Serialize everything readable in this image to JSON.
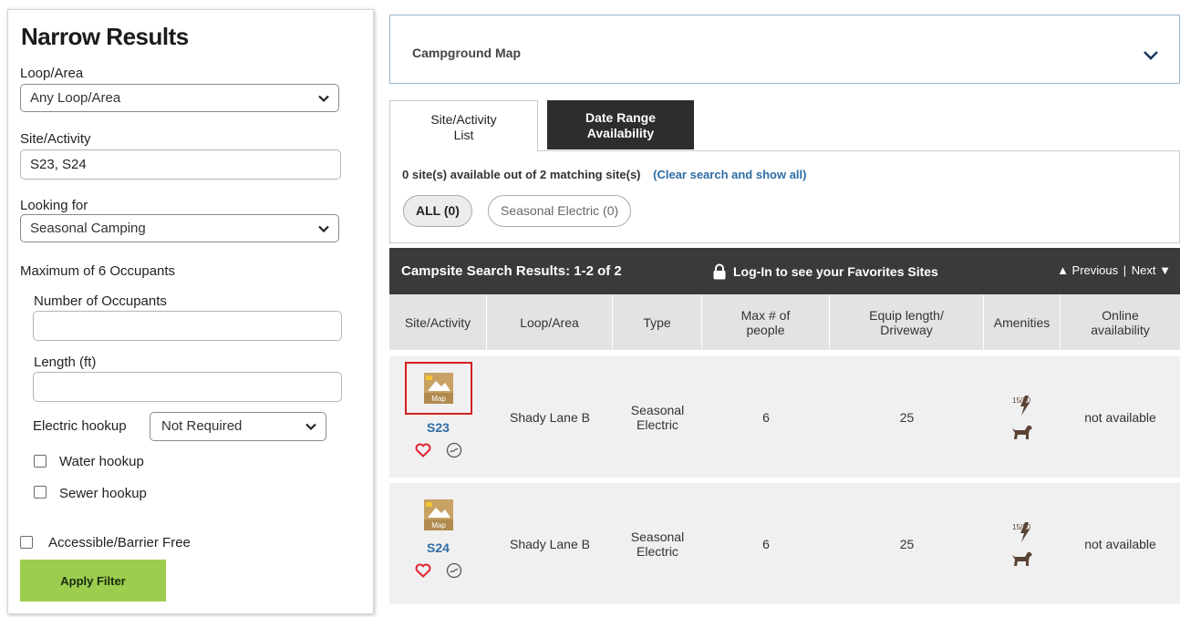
{
  "sidebar": {
    "title": "Narrow Results",
    "loop_label": "Loop/Area",
    "loop_value": "Any Loop/Area",
    "site_label": "Site/Activity",
    "site_value": "S23, S24",
    "looking_label": "Looking for",
    "looking_value": "Seasonal Camping",
    "max_occupants": "Maximum of 6 Occupants",
    "occupants_label": "Number of Occupants",
    "occupants_value": "",
    "length_label": "Length (ft)",
    "length_value": "",
    "electric_label": "Electric hookup",
    "electric_value": "Not Required",
    "water_label": "Water hookup",
    "sewer_label": "Sewer hookup",
    "accessible_label": "Accessible/Barrier Free",
    "apply_label": "Apply Filter"
  },
  "map_bar": {
    "label": "Campground Map"
  },
  "tabs": {
    "site_line1": "Site/Activity",
    "site_line2": "List",
    "date_line1": "Date Range",
    "date_line2": "Availability"
  },
  "results": {
    "availability_text": "0 site(s) available out of 2 matching site(s)",
    "clear_link": "(Clear search and show all)",
    "filter_all": "ALL (0)",
    "filter_seasonal": "Seasonal Electric (0)"
  },
  "header": {
    "title": "Campsite Search Results: 1-2 of 2",
    "login_text": "Log-In to see your Favorites Sites",
    "previous": "▲ Previous",
    "separator": "|",
    "next": "Next ▼"
  },
  "table": {
    "columns": {
      "site": "Site/Activity",
      "loop": "Loop/Area",
      "type": "Type",
      "max_line1": "Max # of",
      "max_line2": "people",
      "equip_line1": "Equip length/",
      "equip_line2": "Driveway",
      "amenities": "Amenities",
      "online_line1": "Online",
      "online_line2": "availability"
    },
    "rows": [
      {
        "site": "S23",
        "loop": "Shady Lane B",
        "type_line1": "Seasonal",
        "type_line2": "Electric",
        "max_people": "6",
        "equip_length": "25",
        "availability": "not available",
        "map_badge": "Map",
        "amp_text": "15/30"
      },
      {
        "site": "S24",
        "loop": "Shady Lane B",
        "type_line1": "Seasonal",
        "type_line2": "Electric",
        "max_people": "6",
        "equip_length": "25",
        "availability": "not available",
        "map_badge": "Map",
        "amp_text": "15/30"
      }
    ]
  },
  "colors": {
    "apply_button": "#9ccd4e",
    "dark_header": "#3a3a3a",
    "link_blue": "#2e6da4",
    "heart_red": "#e0222e",
    "amenity_brown": "#5a4334",
    "map_icon_tan": "#c8a265",
    "selection_red": "#d61f1f"
  }
}
